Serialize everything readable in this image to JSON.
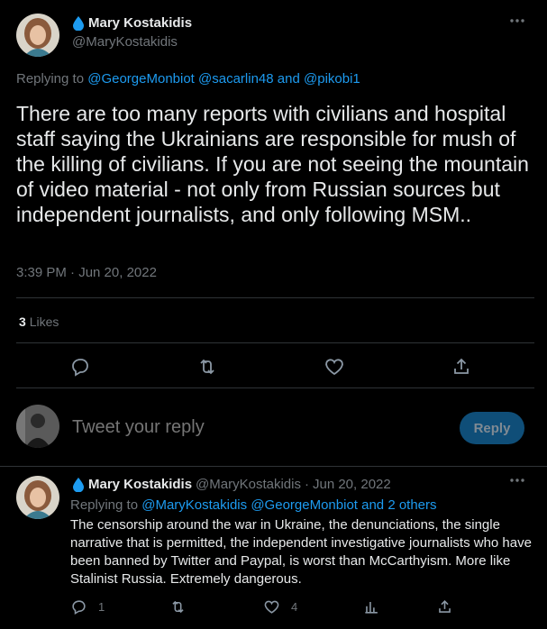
{
  "main_tweet": {
    "author": {
      "display_name": "Mary Kostakidis",
      "handle": "@MaryKostakidis",
      "badge_icon": "water-drop-icon"
    },
    "replying_prefix": "Replying to ",
    "replying_mention_1": "@GeorgeMonbiot",
    "replying_mention_2": "@sacarlin48",
    "replying_and": "and",
    "replying_mention_3": "@pikobi1",
    "text": "There are too many reports with civilians and hospital staff saying the Ukrainians are responsible for mush of the  killing of civilians. If you are not seeing the mountain of video material - not only from Russian sources but independent journalists, and only following MSM..",
    "timestamp": "3:39 PM · Jun 20, 2022",
    "likes_count": "3",
    "likes_label": "Likes",
    "actions": [
      "reply-icon",
      "retweet-icon",
      "like-icon",
      "share-icon"
    ]
  },
  "composer": {
    "placeholder": "Tweet your reply",
    "button_label": "Reply"
  },
  "reply_tweet": {
    "display_name": "Mary Kostakidis",
    "handle": "@MaryKostakidis",
    "separator": "·",
    "date": "Jun 20, 2022",
    "replying_prefix": "Replying to ",
    "replying_mention_1": "@MaryKostakidis",
    "replying_mention_2": "@GeorgeMonbiot",
    "replying_others": "and 2 others",
    "text": "The censorship around the  war in Ukraine, the denunciations, the single narrative that is permitted, the independent investigative journalists who have been banned by Twitter and Paypal, is worst than McCarthyism. More like Stalinist Russia. Extremely dangerous.",
    "reply_count": "1",
    "retweet_count": "",
    "like_count": "4"
  },
  "colors": {
    "background": "#000000",
    "text": "#e7e9ea",
    "muted": "#71767b",
    "accent": "#1d9bf0",
    "divider": "#2f3336",
    "reply_button_disabled": "#0f4e78"
  }
}
